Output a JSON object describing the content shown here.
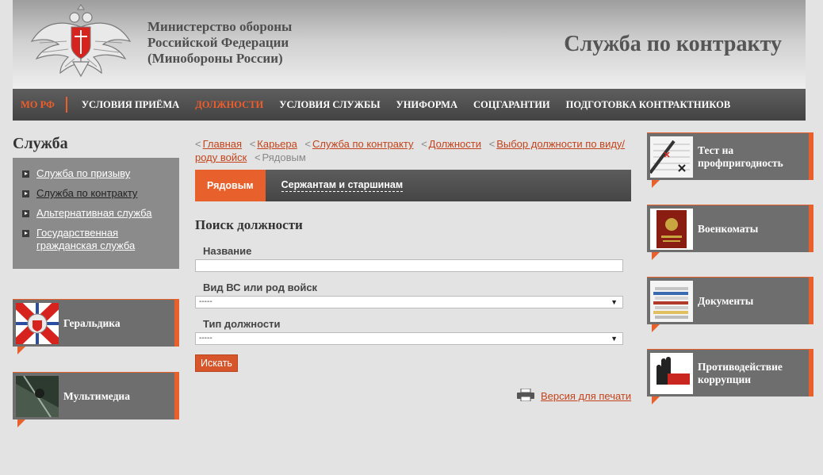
{
  "header": {
    "ministry_line1": "Министерство обороны",
    "ministry_line2": "Российской Федерации",
    "ministry_line3": "(Минобороны России)",
    "site_title": "Служба по контракту"
  },
  "topnav": {
    "items": [
      "МО РФ",
      "УСЛОВИЯ ПРИЁМА",
      "ДОЛЖНОСТИ",
      "УСЛОВИЯ СЛУЖБЫ",
      "УНИФОРМА",
      "СОЦГАРАНТИИ",
      "ПОДГОТОВКА КОНТРАКТНИКОВ"
    ]
  },
  "left": {
    "title": "Служба",
    "menu": [
      "Служба по призыву",
      "Служба по контракту",
      "Альтернативная служба",
      "Государственная гражданская служба"
    ],
    "tiles": [
      "Геральдика",
      "Мультимедиа"
    ]
  },
  "breadcrumb": {
    "items": [
      "Главная",
      "Карьера",
      "Служба по контракту",
      "Должности",
      "Выбор должности по виду/роду войск"
    ],
    "current": "Рядовым"
  },
  "tabs": {
    "active": "Рядовым",
    "other": "Сержантам и старшинам"
  },
  "form": {
    "title": "Поиск должности",
    "name_label": "Название",
    "name_value": "",
    "branch_label": "Вид ВС или род войск",
    "branch_value": "-----",
    "type_label": "Тип должности",
    "type_value": "-----",
    "search_button": "Искать",
    "print_link": "Версия для печати"
  },
  "right": {
    "tiles": [
      "Тест на профпригодность",
      "Военкоматы",
      "Документы",
      "Противодействие коррупции"
    ]
  },
  "colors": {
    "accent": "#e8612c",
    "nav_bg": "#4e4e4e",
    "tile_bg": "#6e6e6e",
    "page_bg": "#e3e3e3"
  }
}
